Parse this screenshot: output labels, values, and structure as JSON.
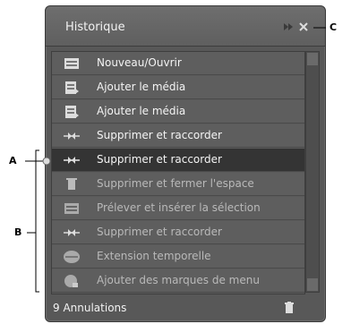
{
  "panel": {
    "title": "Historique",
    "footer": "9 Annulations"
  },
  "history": [
    {
      "label": "Nouveau/Ouvrir",
      "icon": "new-open-icon",
      "state": "normal"
    },
    {
      "label": "Ajouter le média",
      "icon": "add-media-icon",
      "state": "normal"
    },
    {
      "label": "Ajouter le média",
      "icon": "add-media-icon",
      "state": "normal"
    },
    {
      "label": "Supprimer et raccorder",
      "icon": "ripple-delete-icon",
      "state": "normal"
    },
    {
      "label": "Supprimer et raccorder",
      "icon": "ripple-delete-icon",
      "state": "selected"
    },
    {
      "label": "Supprimer et fermer l'espace",
      "icon": "trash-icon",
      "state": "undone"
    },
    {
      "label": "Prélever et insérer la sélection",
      "icon": "lift-insert-icon",
      "state": "undone"
    },
    {
      "label": "Supprimer et raccorder",
      "icon": "ripple-delete-icon",
      "state": "undone"
    },
    {
      "label": "Extension temporelle",
      "icon": "time-stretch-icon",
      "state": "undone"
    },
    {
      "label": "Ajouter des marques de menu",
      "icon": "menu-marker-icon",
      "state": "undone"
    }
  ],
  "callouts": {
    "a": "A",
    "b": "B",
    "c": "C"
  },
  "colors": {
    "panel": "#585858",
    "selected_row": "#343434",
    "undone_text": "#b9b9b9"
  }
}
